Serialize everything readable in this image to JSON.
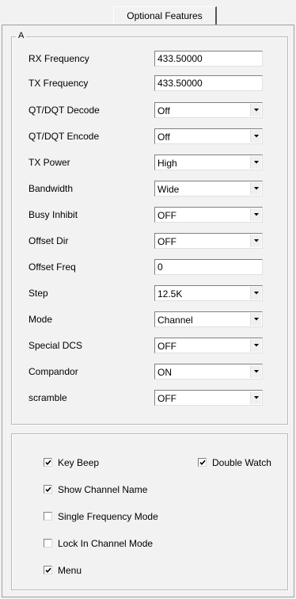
{
  "tabs": {
    "active": "Optional Features"
  },
  "group_a": {
    "label": "A",
    "fields": [
      {
        "label": "RX Frequency",
        "value": "433.50000",
        "kind": "text"
      },
      {
        "label": "TX Frequency",
        "value": "433.50000",
        "kind": "text"
      },
      {
        "label": "QT/DQT Decode",
        "value": "Off",
        "kind": "select"
      },
      {
        "label": "QT/DQT Encode",
        "value": "Off",
        "kind": "select"
      },
      {
        "label": "TX Power",
        "value": "High",
        "kind": "select"
      },
      {
        "label": "Bandwidth",
        "value": "Wide",
        "kind": "select"
      },
      {
        "label": "Busy Inhibit",
        "value": "OFF",
        "kind": "select"
      },
      {
        "label": "Offset Dir",
        "value": "OFF",
        "kind": "select"
      },
      {
        "label": "Offset Freq",
        "value": "0",
        "kind": "text"
      },
      {
        "label": "Step",
        "value": "12.5K",
        "kind": "select"
      },
      {
        "label": "Mode",
        "value": "Channel",
        "kind": "select"
      },
      {
        "label": "Special DCS",
        "value": "OFF",
        "kind": "select"
      },
      {
        "label": "Compandor",
        "value": "ON",
        "kind": "select"
      },
      {
        "label": "scramble",
        "value": "OFF",
        "kind": "select"
      }
    ]
  },
  "options": {
    "key_beep": {
      "label": "Key Beep",
      "checked": true
    },
    "double_watch": {
      "label": "Double Watch",
      "checked": true
    },
    "show_channel_name": {
      "label": "Show Channel Name",
      "checked": true
    },
    "single_frequency_mode": {
      "label": "Single Frequency Mode",
      "checked": false
    },
    "lock_in_channel_mode": {
      "label": "Lock In Channel Mode",
      "checked": false
    },
    "menu": {
      "label": "Menu",
      "checked": true
    }
  },
  "icons": {
    "dropdown": "chevron-down-icon",
    "check": "checkmark-icon"
  }
}
